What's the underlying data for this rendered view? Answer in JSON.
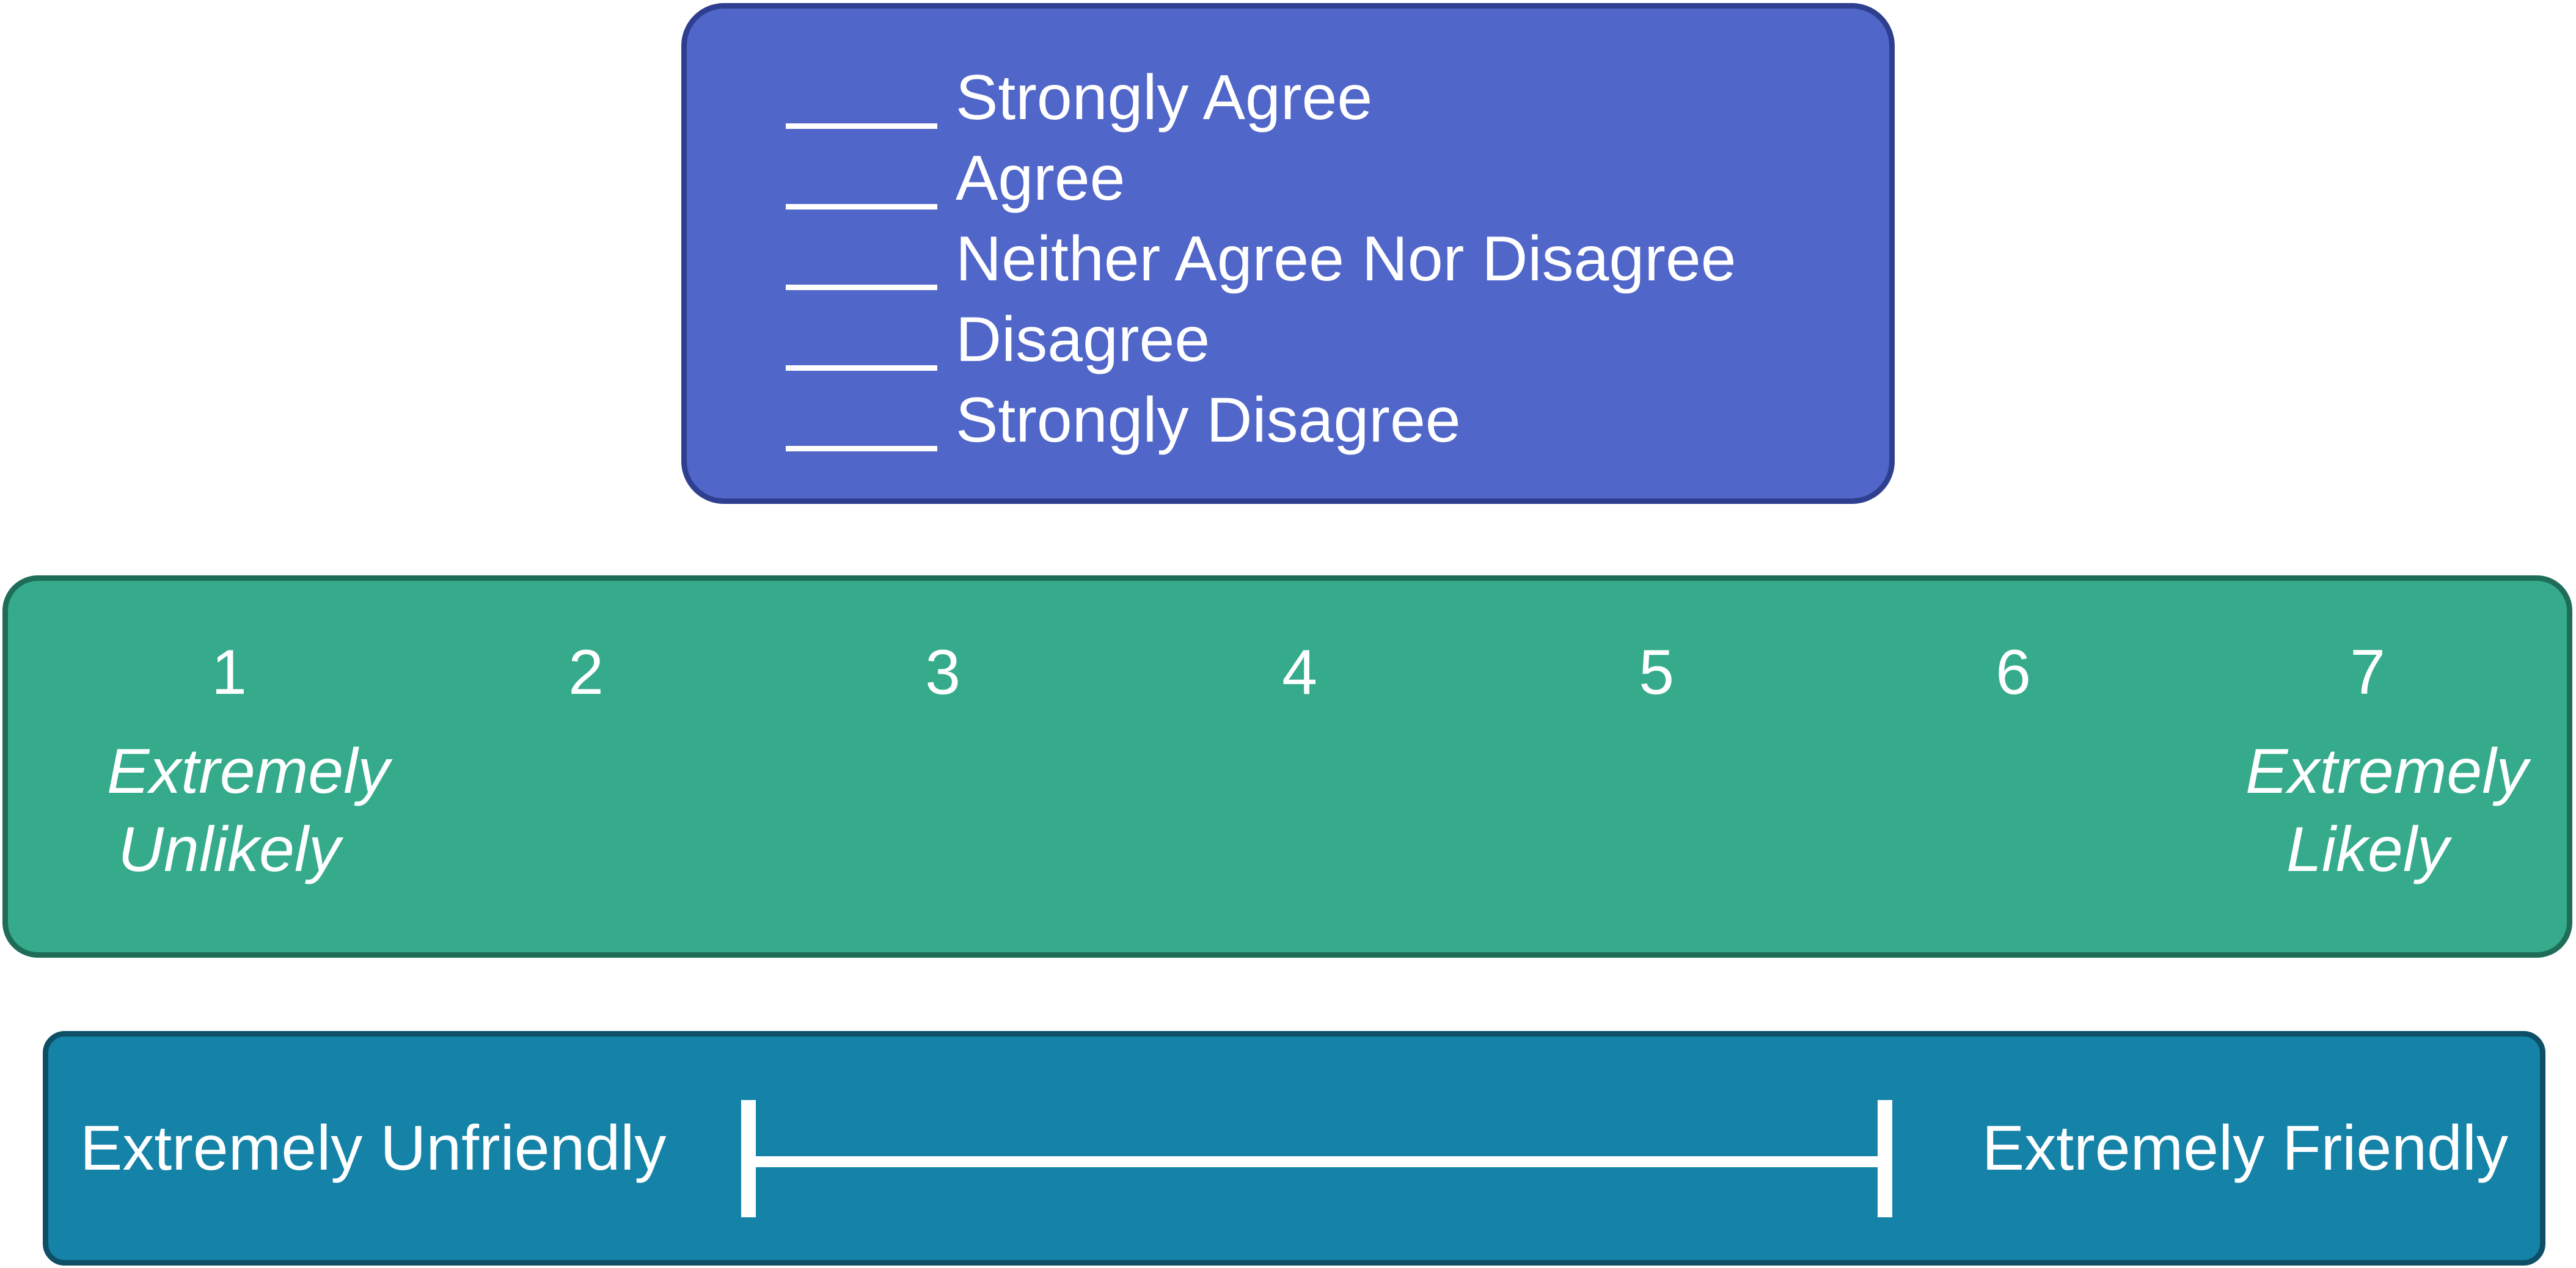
{
  "likert_agreement": {
    "options": [
      "Strongly Agree",
      "Agree",
      "Neither Agree Nor Disagree",
      "Disagree",
      "Strongly Disagree"
    ]
  },
  "numeric_scale": {
    "points": [
      "1",
      "2",
      "3",
      "4",
      "5",
      "6",
      "7"
    ],
    "low_anchor": "Extremely\nUnlikely",
    "high_anchor": "Extremely\nLikely"
  },
  "semantic_differential": {
    "left_label": "Extremely Unfriendly",
    "right_label": "Extremely Friendly"
  },
  "colors": {
    "likert_fill": "#5066c9",
    "numeric_fill": "#35ab8c",
    "differential_fill": "#1582a8",
    "text": "#ffffff"
  }
}
